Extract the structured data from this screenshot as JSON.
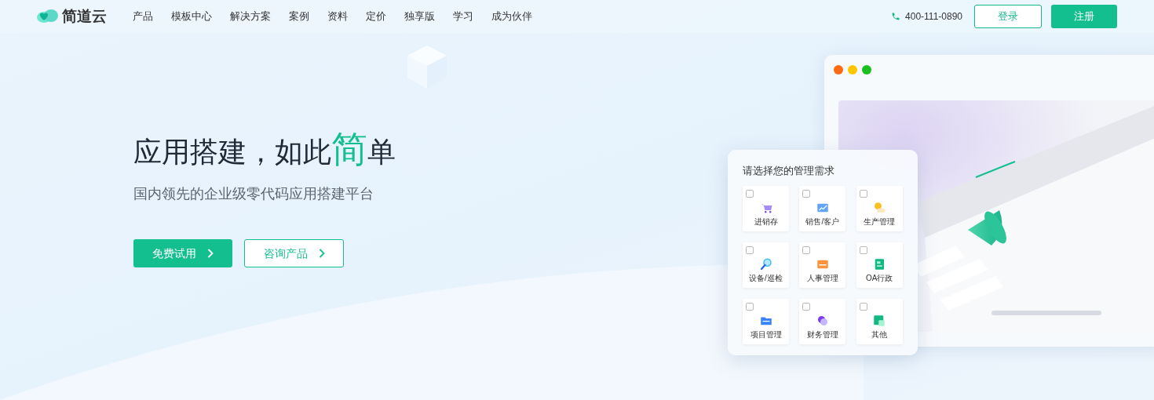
{
  "brand": {
    "name": "简道云"
  },
  "nav": {
    "items": [
      {
        "label": "产品"
      },
      {
        "label": "模板中心"
      },
      {
        "label": "解决方案"
      },
      {
        "label": "案例"
      },
      {
        "label": "资料"
      },
      {
        "label": "定价"
      },
      {
        "label": "独享版"
      },
      {
        "label": "学习"
      },
      {
        "label": "成为伙伴"
      }
    ],
    "phone": "400-111-0890",
    "login": "登录",
    "register": "注册"
  },
  "hero": {
    "title": [
      {
        "text": "应用搭建，如此",
        "accent": false
      },
      {
        "text": "简",
        "accent": true
      },
      {
        "text": "单",
        "accent": false
      }
    ],
    "subtitle": "国内领先的企业级零代码应用搭建平台",
    "buttons": [
      {
        "label": "免费试用",
        "kind": "primary"
      },
      {
        "label": "咨询产品",
        "kind": "outline"
      }
    ]
  },
  "picker": {
    "title": "请选择您的管理需求",
    "options": [
      {
        "label": "进销存",
        "checked": false
      },
      {
        "label": "销售/客户",
        "checked": false
      },
      {
        "label": "生产管理",
        "checked": false
      },
      {
        "label": "设备/巡检",
        "checked": false
      },
      {
        "label": "人事管理",
        "checked": false
      },
      {
        "label": "OA行政",
        "checked": false
      },
      {
        "label": "项目管理",
        "checked": false
      },
      {
        "label": "财务管理",
        "checked": false
      },
      {
        "label": "其他",
        "checked": false
      }
    ]
  }
}
